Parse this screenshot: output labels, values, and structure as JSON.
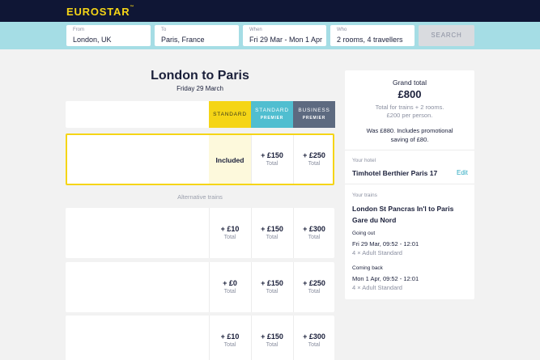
{
  "header": {
    "logo_text": "EUROSTAR",
    "logo_tm": "™"
  },
  "search": {
    "from": {
      "label": "From",
      "value": "London, UK"
    },
    "to": {
      "label": "To",
      "value": "Paris, France"
    },
    "when": {
      "label": "When",
      "value": "Fri 29 Mar - Mon 1 Apr"
    },
    "who": {
      "label": "Who",
      "value": "2 rooms, 4 travellers"
    },
    "button_label": "SEARCH"
  },
  "journey": {
    "title": "London to Paris",
    "date": "Friday 29 March"
  },
  "classes": {
    "standard": "STANDARD",
    "standard_premier": {
      "line1": "STANDARD",
      "line2": "PREMIER"
    },
    "business_premier": {
      "line1": "BUSINESS",
      "line2": "PREMIER"
    }
  },
  "selected_train": {
    "standard": "Included",
    "standard_premier": {
      "price": "+ £150",
      "sub": "Total"
    },
    "business_premier": {
      "price": "+ £250",
      "sub": "Total"
    }
  },
  "alternative_label": "Alternative trains",
  "alternatives": [
    {
      "standard": {
        "price": "+ £10",
        "sub": "Total"
      },
      "standard_premier": {
        "price": "+ £150",
        "sub": "Total"
      },
      "business_premier": {
        "price": "+ £300",
        "sub": "Total"
      }
    },
    {
      "standard": {
        "price": "+ £0",
        "sub": "Total"
      },
      "standard_premier": {
        "price": "+ £150",
        "sub": "Total"
      },
      "business_premier": {
        "price": "+ £250",
        "sub": "Total"
      }
    },
    {
      "standard": {
        "price": "+ £10",
        "sub": "Total"
      },
      "standard_premier": {
        "price": "+ £150",
        "sub": "Total"
      },
      "business_premier": {
        "price": "+ £300",
        "sub": "Total"
      }
    }
  ],
  "summary": {
    "label": "Grand total",
    "price": "£800",
    "line1": "Total for trains + 2 rooms.",
    "line2": "£200 per person.",
    "was_line1": "Was £880. Includes promotional",
    "was_line2": "saving of £80.",
    "hotel_label": "Your hotel",
    "hotel_name": "Timhotel Berthier Paris 17",
    "edit_label": "Edit",
    "trains_label": "Your trains",
    "train_line1": "London St Pancras In'l to Paris",
    "train_line2": "Gare du Nord",
    "going_out": {
      "label": "Going out",
      "value": "Fri 29 Mar, 09:52 - 12:01",
      "tickets": "4 × Adult Standard"
    },
    "coming_back": {
      "label": "Coming back",
      "value": "Mon 1 Apr, 09:52 - 12:01",
      "tickets": "4 × Adult Standard"
    }
  },
  "colors": {
    "navy": "#0f1635",
    "yellow": "#f5d516",
    "teal": "#50bed0",
    "slate": "#5d6a80",
    "searchbar": "#a5dde5"
  }
}
